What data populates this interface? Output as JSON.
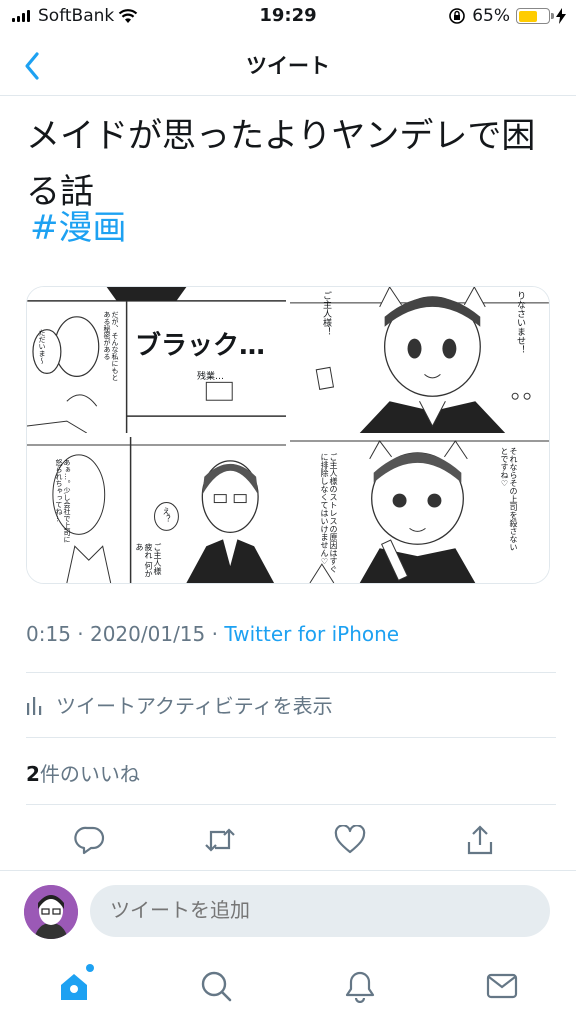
{
  "status": {
    "carrier": "SoftBank",
    "time": "19:29",
    "battery_percent_text": "65%",
    "battery_level": 0.65
  },
  "nav": {
    "title": "ツイート"
  },
  "tweet": {
    "text": "メイドが思ったよりヤンデレで困る話",
    "hashtag": "#漫画",
    "timestamp": "0:15 · 2020/01/15 · ",
    "source": "Twitter for iPhone"
  },
  "media": {
    "panel1": {
      "text_a": "ブラック…",
      "text_b": "ただいま〜",
      "text_c": "だが、そんな私にもとある秘密がある",
      "text_d": "残業…"
    },
    "panel2": {
      "text_a": "ご主人様！",
      "text_b": "りなさいませ！"
    },
    "panel3": {
      "text_a": "あぁ…。少し会社で上司に怒られちゃってね…",
      "text_b": "え？",
      "text_c": "ご主人様 疲れ 何かあ"
    },
    "panel4": {
      "text_a": "ご主人様のストレスの原因はすぐに排除しなくてはいけません♡",
      "text_b": "それならその上司を殺さないとですね♡"
    }
  },
  "activity": {
    "label": "ツイートアクティビティを表示"
  },
  "likes": {
    "count": "2",
    "label": "件のいいね"
  },
  "reply": {
    "placeholder": "ツイートを追加"
  },
  "colors": {
    "accent": "#1da1f2",
    "text": "#14171a",
    "muted": "#657786",
    "divider": "#e1e8ed",
    "battery": "#ffcc00"
  },
  "icons": [
    "wifi-icon",
    "lock-rotation-icon",
    "charging-icon",
    "back-chevron-icon",
    "activity-bars-icon",
    "reply-icon",
    "retweet-icon",
    "like-icon",
    "share-icon",
    "home-icon",
    "search-icon",
    "notifications-icon",
    "messages-icon"
  ]
}
